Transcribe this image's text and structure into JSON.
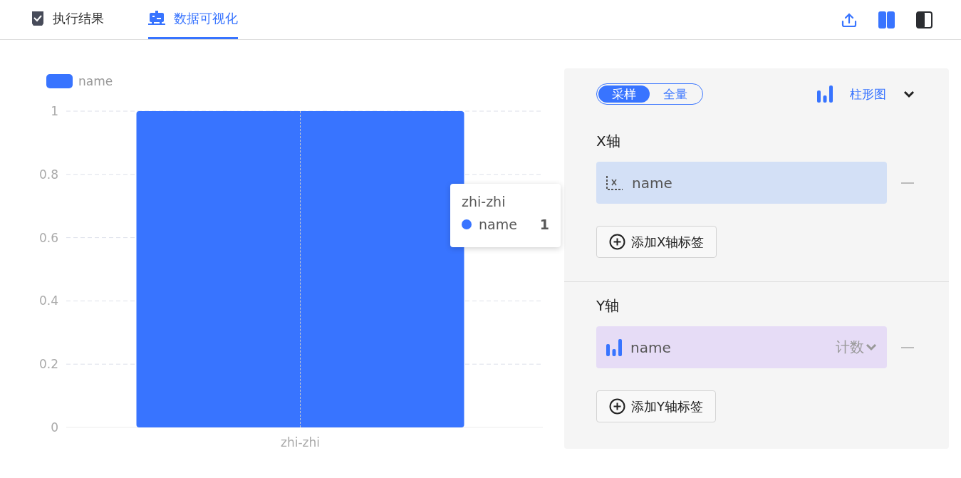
{
  "tabs": [
    {
      "label": "执行结果",
      "kind": "result",
      "selected": false
    },
    {
      "label": "数据可视化",
      "kind": "visual",
      "selected": true
    }
  ],
  "toolbar": [
    {
      "kind": "upload",
      "selected": false
    },
    {
      "kind": "split",
      "selected": true
    },
    {
      "kind": "sidebar",
      "selected": false
    }
  ],
  "chart": {
    "chart_data": {
      "type": "bar",
      "categories": [
        "zhi-zhi"
      ],
      "series": [
        {
          "name": "name",
          "color": "#3874ff",
          "values": [
            1
          ]
        }
      ],
      "ylim": [
        0,
        1
      ],
      "grid": true,
      "yticks": [
        {
          "value": 0,
          "label": "0"
        },
        {
          "value": 0.2,
          "label": "0.2"
        },
        {
          "value": 0.4,
          "label": "0.4"
        },
        {
          "value": 0.6,
          "label": "0.6"
        },
        {
          "value": 0.8,
          "label": "0.8"
        },
        {
          "value": 1,
          "label": "1"
        }
      ]
    },
    "tooltip": {
      "title": "zhi-zhi",
      "series": "name",
      "value": "1",
      "color": "#3874ff"
    }
  },
  "panel": {
    "modes": [
      {
        "label": "采样",
        "selected": true
      },
      {
        "label": "全量",
        "selected": false
      }
    ],
    "chart_type": "柱形图",
    "x_axis": {
      "title": "X轴",
      "field": "name",
      "add_button": "添加X轴标签"
    },
    "y_axis": {
      "title": "Y轴",
      "field": "name",
      "aggregation": "计数",
      "add_button": "添加Y轴标签"
    }
  }
}
